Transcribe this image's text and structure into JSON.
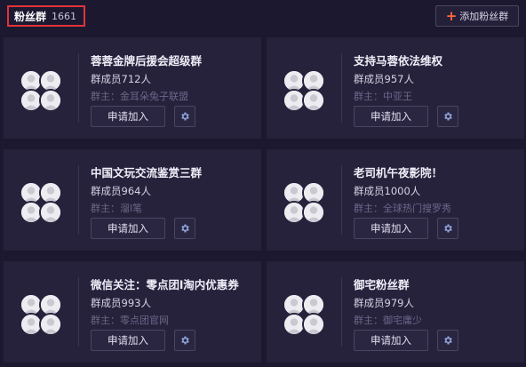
{
  "header": {
    "title": "粉丝群",
    "count": "1661",
    "add_button": "添加粉丝群"
  },
  "groups": [
    {
      "name": "蓉蓉金牌后援会超级群",
      "members": "群成员712人",
      "owner": "群主：金耳朵兔子联盟",
      "join": "申请加入"
    },
    {
      "name": "支持马蓉依法维权",
      "members": "群成员957人",
      "owner": "群主：中亚王",
      "join": "申请加入"
    },
    {
      "name": "中国文玩交流鉴赏三群",
      "members": "群成员964人",
      "owner": "群主：溜l笔",
      "join": "申请加入"
    },
    {
      "name": "老司机午夜影院！",
      "members": "群成员1000人",
      "owner": "群主：全球热门搜罗秀",
      "join": "申请加入"
    },
    {
      "name": "微信关注：零点团l淘内优惠券",
      "members": "群成员993人",
      "owner": "群主：零点团官网",
      "join": "申请加入"
    },
    {
      "name": "御宅粉丝群",
      "members": "群成员979人",
      "owner": "群主：御宅庸少",
      "join": "申请加入"
    }
  ],
  "icons": {
    "add": "plus-icon",
    "settings": "gear-icon",
    "avatar": "default-avatar-icon"
  },
  "colors": {
    "background": "#1c1830",
    "card": "#26223c",
    "accent": "#ff6a3d",
    "highlight_border": "#e0343a"
  }
}
